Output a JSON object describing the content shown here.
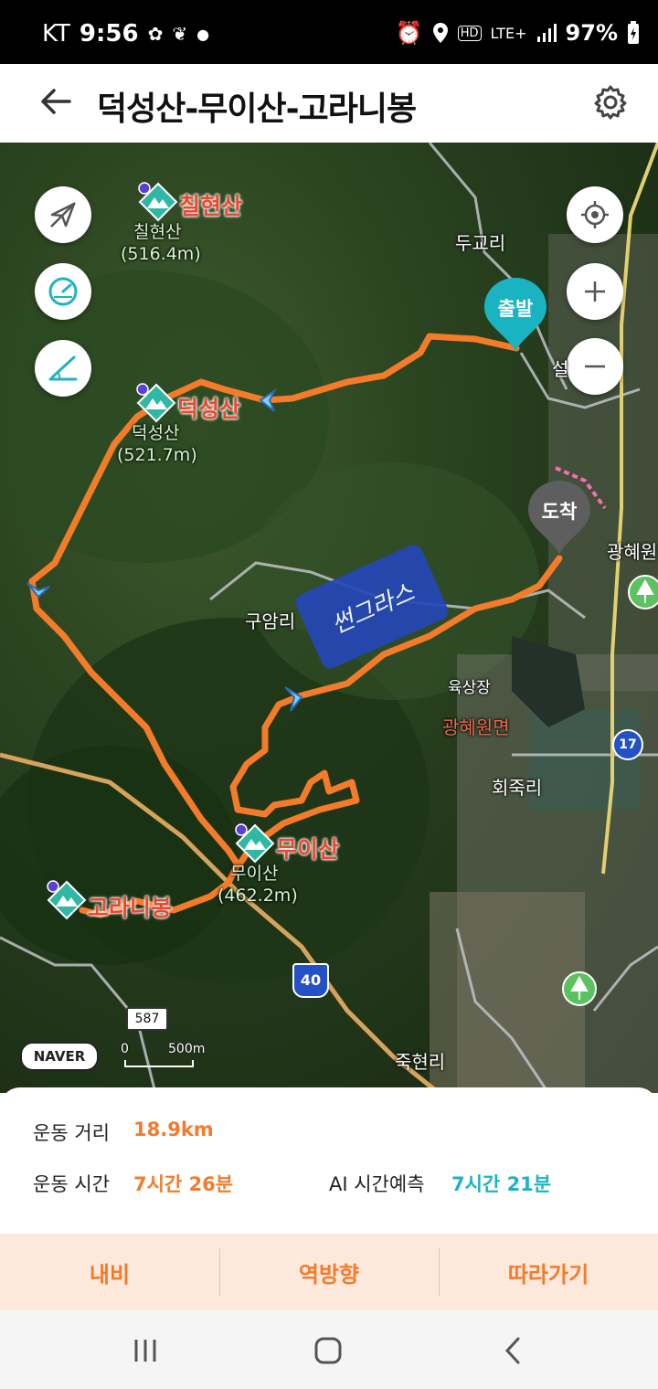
{
  "status_bar": {
    "carrier": "KT",
    "time": "9:56",
    "network": "LTE+",
    "battery": "97%",
    "icons": [
      "walking-icon",
      "leaf-icon",
      "dot-icon",
      "alarm-icon",
      "location-icon",
      "hd-icon",
      "signal-icon",
      "battery-icon"
    ]
  },
  "header": {
    "title": "덕성산-무이산-고라니봉",
    "back_icon": "arrow-left-icon",
    "settings_icon": "gear-icon"
  },
  "map": {
    "left_controls": [
      "tracking-off-icon",
      "speedometer-icon",
      "slope-icon"
    ],
    "right_controls": [
      "locate-icon",
      "zoom-in-icon",
      "zoom-out-icon"
    ],
    "peaks": [
      {
        "title": "칠현산",
        "name": "칠현산",
        "elevation": "(516.4m)"
      },
      {
        "title": "덕성산",
        "name": "덕성산",
        "elevation": "(521.7m)"
      },
      {
        "title": "무이산",
        "name": "무이산",
        "elevation": "(462.2m)"
      },
      {
        "title": "고라니봉"
      }
    ],
    "start_marker": "출발",
    "end_marker": "도착",
    "places": {
      "dugyo": "두교리",
      "guam": "구암리",
      "yuksang": "육상장",
      "gwanghyewon_myeon": "광혜원면",
      "hoejuk": "회죽리",
      "jukhyeon": "죽현리",
      "gwanghye": "광혜원",
      "partial_seol": "설"
    },
    "annotation": "썬그라스",
    "route_shields": {
      "hw40": "40",
      "r17": "17",
      "r587": "587"
    },
    "logo": "NAVER",
    "scale_zero": "0",
    "scale_label": "500m",
    "route_color": "#f47b2a"
  },
  "stats": {
    "distance_label": "운동 거리",
    "distance_value": "18.9km",
    "time_label": "운동 시간",
    "time_value": "7시간 26분",
    "ai_label": "AI 시간예측",
    "ai_value": "7시간 21분",
    "accent_color": "#f47b2a",
    "ai_color": "#1fb3c2"
  },
  "actions": {
    "navi": "내비",
    "reverse": "역방향",
    "follow": "따라가기"
  },
  "navbar": {
    "icons": [
      "recent-apps-icon",
      "home-icon",
      "back-nav-icon"
    ]
  }
}
